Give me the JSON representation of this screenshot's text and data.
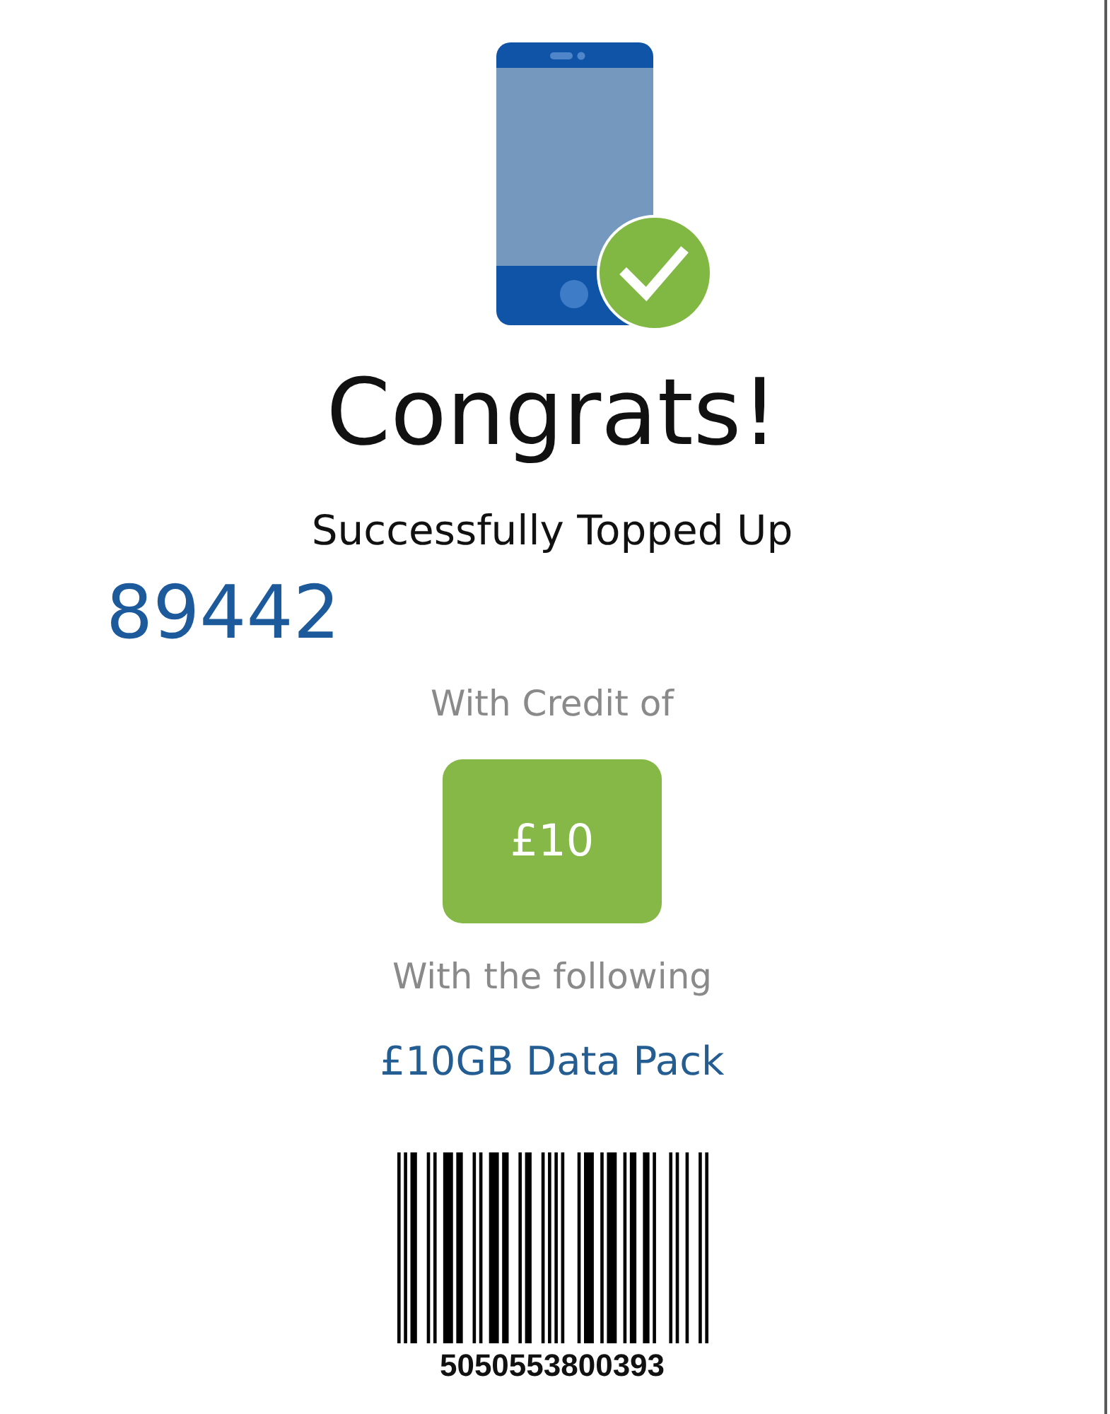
{
  "title": "Congrats!",
  "subtitle": "Successfully Topped Up",
  "topped_up_number": "89442",
  "credit": {
    "label": "With Credit of",
    "amount": "£10"
  },
  "bundle": {
    "label": "With the following",
    "name": "£10GB Data Pack"
  },
  "barcode": {
    "number": "5050553800393"
  }
}
